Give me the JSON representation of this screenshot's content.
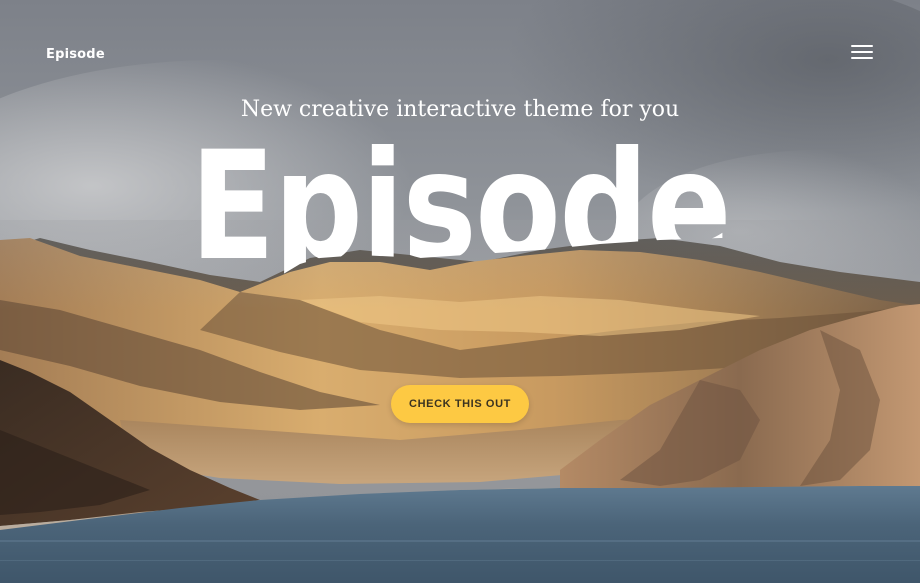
{
  "header": {
    "logo_text": "Episode",
    "menu_icon": "hamburger-menu-icon"
  },
  "hero": {
    "tagline": "New creative interactive theme for you",
    "headline": "Episode",
    "cta_label": "CHECK THIS OUT"
  },
  "colors": {
    "cta_background": "#fdc943",
    "headline": "#ffffff",
    "water": "#4b6479"
  }
}
